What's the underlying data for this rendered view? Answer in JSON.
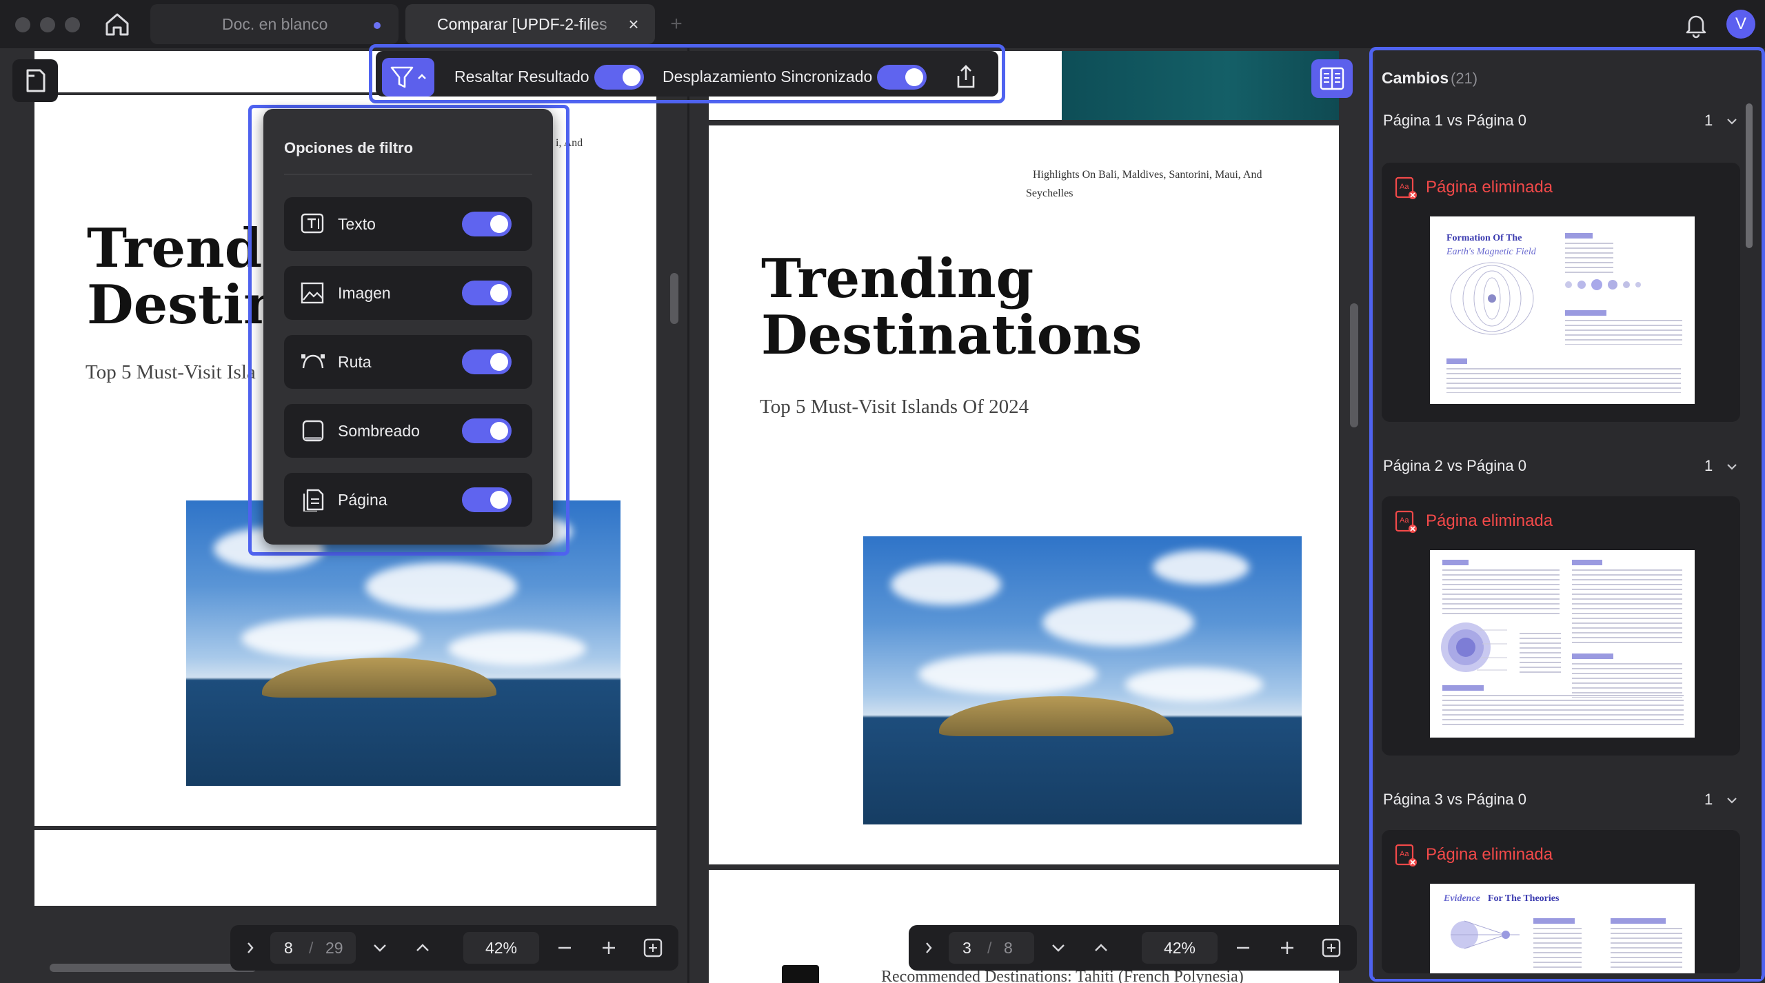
{
  "tabs": {
    "blank_label": "Doc. en blanco",
    "compare_label": "Comparar [UPDF-2-files",
    "user_initial": "V"
  },
  "toolbar": {
    "highlight_label": "Resaltar Resultado",
    "highlight_on": true,
    "sync_scroll_label": "Desplazamiento Sincronizado",
    "sync_scroll_on": true
  },
  "filter": {
    "title": "Opciones de filtro",
    "options": [
      {
        "label": "Texto",
        "icon": "text-icon",
        "enabled": true
      },
      {
        "label": "Imagen",
        "icon": "image-icon",
        "enabled": true
      },
      {
        "label": "Ruta",
        "icon": "path-icon",
        "enabled": true
      },
      {
        "label": "Sombreado",
        "icon": "shading-icon",
        "enabled": true
      },
      {
        "label": "Página",
        "icon": "page-icon",
        "enabled": true
      }
    ]
  },
  "left_doc": {
    "title_line1": "Trendin",
    "title_line2": "Destina",
    "subtitle": "Top 5 Must-Visit Isla",
    "header_frag": "i, And",
    "page_current": "8",
    "page_total": "29",
    "zoom": "42%"
  },
  "right_doc": {
    "header_line1": "Highlights On Bali, Maldives, Santorini, Maui, And",
    "header_line2": "Seychelles",
    "title_line1": "Trending",
    "title_line2": "Destinations",
    "subtitle": "Top 5 Must-Visit Islands Of 2024",
    "footer_frag": "Recommended Destinations: Tahiti (French Polynesia)",
    "page_current": "3",
    "page_total": "8",
    "zoom": "42%"
  },
  "changes": {
    "title": "Cambios",
    "count": "(21)",
    "groups": [
      {
        "label": "Página 1 vs Página 0",
        "count": "1",
        "change": "Página eliminada",
        "thumb_title": "Formation Of The",
        "thumb_subtitle": "Earth's Magnetic Field"
      },
      {
        "label": "Página 2 vs Página 0",
        "count": "1",
        "change": "Página eliminada"
      },
      {
        "label": "Página 3 vs Página 0",
        "count": "1",
        "change": "Página eliminada",
        "thumb_title_a": "Evidence",
        "thumb_title_b": "For The Theories"
      }
    ]
  },
  "colors": {
    "accent": "#5c60ec",
    "highlight_border": "#4f63f0",
    "deleted_red": "#f24949",
    "panel_bg": "#1f1f22"
  }
}
